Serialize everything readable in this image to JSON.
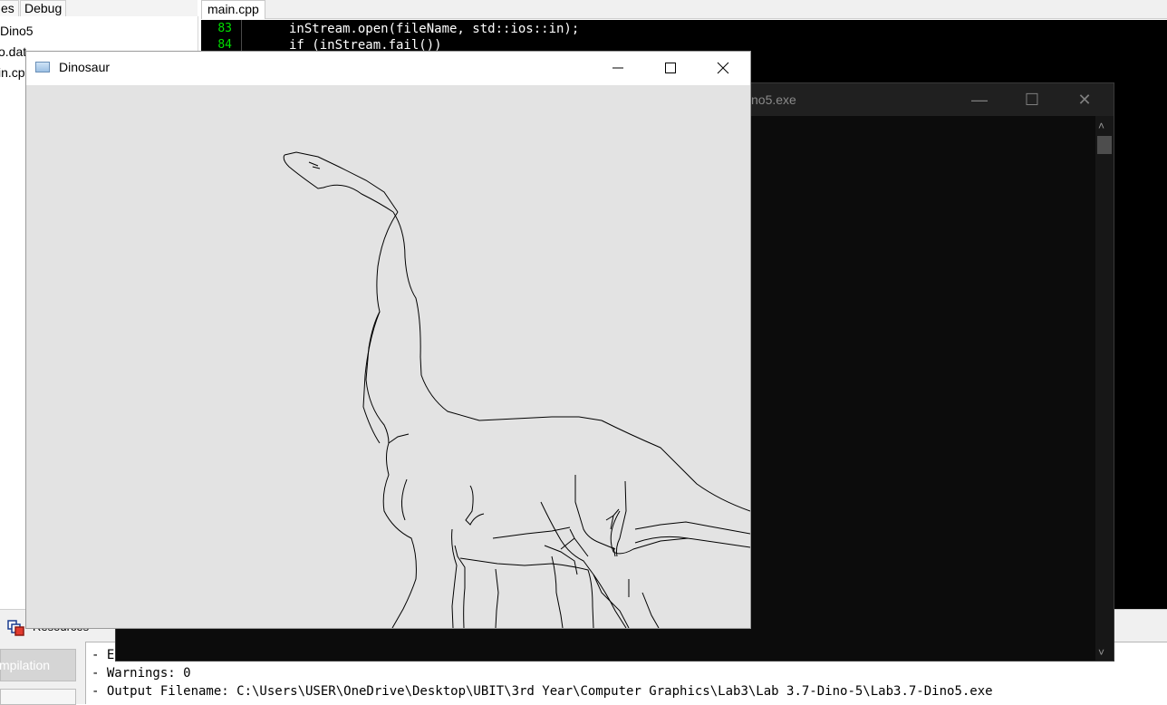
{
  "ide": {
    "top_tabs": [
      "es",
      "Debug"
    ],
    "tree_items": [
      "Dino5",
      "o.dat",
      "in.cp"
    ],
    "editor_tab": "main.cpp",
    "code_lines": [
      {
        "no": "83",
        "text": "inStream.open(fileName, std::ios::in);"
      },
      {
        "no": "84",
        "text": "if (inStream.fail())"
      }
    ],
    "resources_tab": "Resources",
    "compilation_button": "mpilation",
    "log_lines": [
      "- E",
      "- Warnings: 0",
      "- Output Filename: C:\\Users\\USER\\OneDrive\\Desktop\\UBIT\\3rd Year\\Computer Graphics\\Lab3\\Lab 3.7-Dino-5\\Lab3.7-Dino5.exe"
    ]
  },
  "console": {
    "title": "no5.exe"
  },
  "dino_window": {
    "title": "Dinosaur",
    "minimize_icon": "minimize-icon",
    "maximize_icon": "maximize-icon",
    "close_icon": "close-icon",
    "canvas_bg": "#e3e3e3",
    "stroke_color": "#000000"
  }
}
